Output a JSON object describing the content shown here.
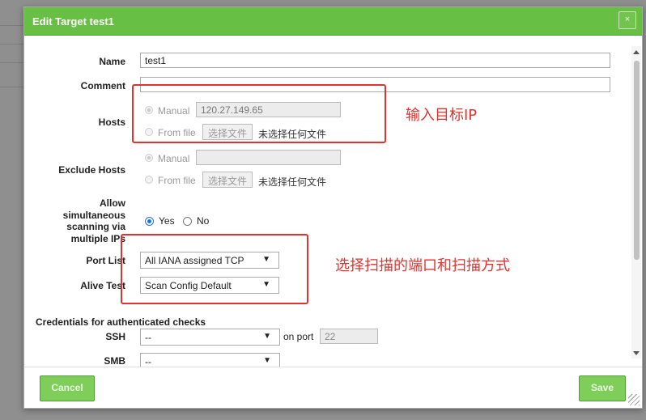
{
  "dialog": {
    "title": "Edit Target test1",
    "close_glyph": "×",
    "accent_color": "#67bf43"
  },
  "form": {
    "name": {
      "label": "Name",
      "value": "test1"
    },
    "comment": {
      "label": "Comment",
      "value": ""
    },
    "hosts": {
      "label": "Hosts",
      "manual_label": "Manual",
      "manual_value": "120.27.149.65",
      "from_file_label": "From file",
      "file_button": "选择文件",
      "file_status": "未选择任何文件",
      "selected": "manual"
    },
    "exclude_hosts": {
      "label": "Exclude Hosts",
      "manual_label": "Manual",
      "manual_value": "",
      "from_file_label": "From file",
      "file_button": "选择文件",
      "file_status": "未选择任何文件"
    },
    "allow_simultaneous": {
      "label_lines": [
        "Allow",
        "simultaneous",
        "scanning via",
        "multiple IPs"
      ],
      "yes_label": "Yes",
      "no_label": "No",
      "selected": "yes"
    },
    "port_list": {
      "label": "Port List",
      "value": "All IANA assigned TCP"
    },
    "alive_test": {
      "label": "Alive Test",
      "value": "Scan Config Default"
    },
    "credentials": {
      "section_title": "Credentials for authenticated checks",
      "ssh": {
        "label": "SSH",
        "value": "--",
        "on_port_label": "on port",
        "port_value": "22"
      },
      "smb": {
        "label": "SMB",
        "value": "--"
      }
    }
  },
  "annotations": {
    "hosts_note": "输入目标IP",
    "ports_note": "选择扫描的端口和扫描方式",
    "color": "#e0332f"
  },
  "footer": {
    "cancel_label": "Cancel",
    "save_label": "Save"
  },
  "icons": {
    "dropdown": "▼"
  }
}
